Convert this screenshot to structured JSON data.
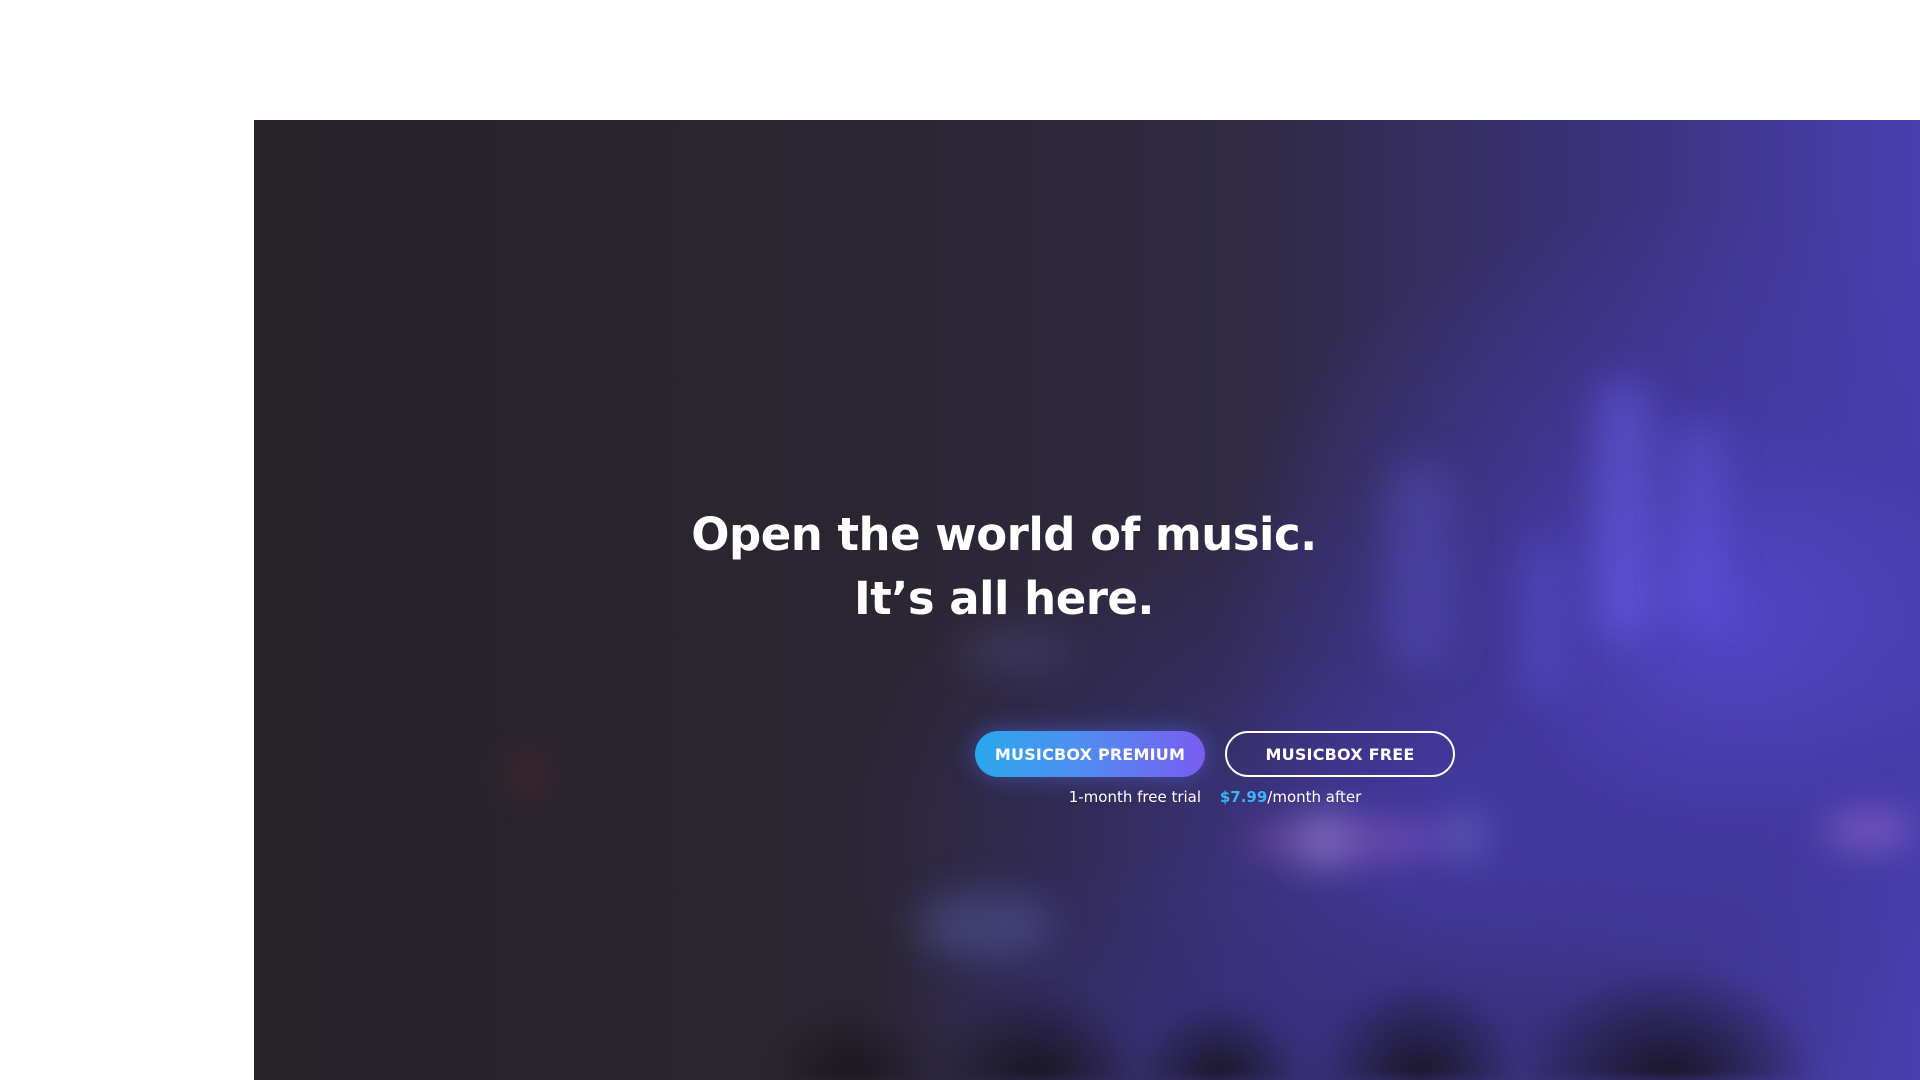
{
  "hero": {
    "headline_line1": "Open the world of music.",
    "headline_line2": "It’s all here.",
    "premium_button_label": "MUSICBOX PREMIUM",
    "free_button_label": "MUSICBOX FREE",
    "trial_text": "1-month free trial",
    "price": "$7.99",
    "price_suffix": "/month after"
  },
  "colors": {
    "background_dark": "#28242a",
    "stage_purple": "#4a3fb0",
    "premium_gradient_start": "#2aa7ee",
    "premium_gradient_end": "#7a5cf0",
    "price_accent": "#38b6f5",
    "text": "#ffffff"
  }
}
